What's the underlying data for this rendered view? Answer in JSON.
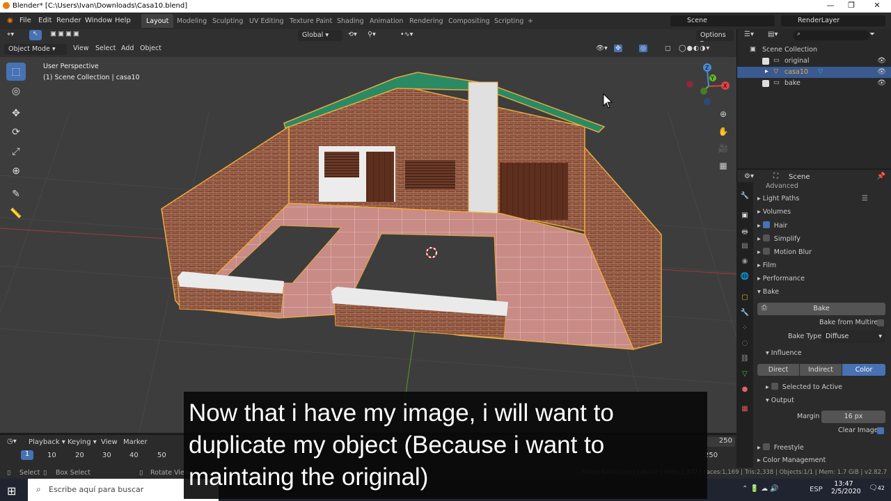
{
  "window": {
    "title": "Blender* [C:\\Users\\Ivan\\Downloads\\Casa10.blend]",
    "minimize": "—",
    "maximize": "❐",
    "close": "✕"
  },
  "menu": {
    "file": "File",
    "edit": "Edit",
    "render": "Render",
    "window": "Window",
    "help": "Help"
  },
  "workspaces": [
    "Layout",
    "Modeling",
    "Sculpting",
    "UV Editing",
    "Texture Paint",
    "Shading",
    "Animation",
    "Rendering",
    "Compositing",
    "Scripting",
    "+"
  ],
  "scene": {
    "name": "Scene",
    "view_layer": "RenderLayer"
  },
  "viewport_header": {
    "transform_orientation": "Global",
    "options": "Options",
    "mode": "Object Mode",
    "view": "View",
    "select": "Select",
    "add": "Add",
    "object": "Object"
  },
  "viewport": {
    "perspective": "User Perspective",
    "collection_info": "(1) Scene Collection | casa10"
  },
  "gizmo": {
    "z": "Z",
    "y": "Y",
    "x": "X"
  },
  "outliner": {
    "root": "Scene Collection",
    "items": [
      {
        "name": "original",
        "selected": false
      },
      {
        "name": "casa10",
        "selected": true
      },
      {
        "name": "bake",
        "selected": false
      }
    ]
  },
  "properties": {
    "context": "Scene",
    "advanced": "Advanced",
    "light_paths": "Light Paths",
    "volumes": "Volumes",
    "hair": "Hair",
    "simplify": "Simplify",
    "motion_blur": "Motion Blur",
    "film": "Film",
    "performance": "Performance",
    "bake_section": "Bake",
    "bake_button": "Bake",
    "bake_from_multires": "Bake from Multires",
    "bake_type_label": "Bake Type",
    "bake_type_value": "Diffuse",
    "influence": "Influence",
    "influence_options": [
      "Direct",
      "Indirect",
      "Color"
    ],
    "selected_to_active": "Selected to Active",
    "output": "Output",
    "margin_label": "Margin",
    "margin_value": "16 px",
    "clear_image": "Clear Image",
    "freestyle": "Freestyle",
    "color_management": "Color Management"
  },
  "timeline": {
    "playback": "Playback",
    "keying": "Keying",
    "view": "View",
    "marker": "Marker",
    "current_frame": "1",
    "end_frame": "250",
    "ticks": [
      "10",
      "20",
      "30",
      "40",
      "50"
    ],
    "right_tick": "250"
  },
  "status": {
    "select": "Select",
    "box_select": "Box Select",
    "rotate_view": "Rotate View",
    "stats": "Scene Collection | casa10 | Verts:1,377 | Faces:1,169 | Tris:2,338 | Objects:1/1 | Mem: 1.7 GiB | v2.82.7"
  },
  "taskbar": {
    "search_placeholder": "Escribe aquí para buscar",
    "lang": "ESP",
    "time": "13:47",
    "date": "2/5/2020",
    "notif": "42"
  },
  "subtitle": "Now that i have my image, i will want to duplicate my object (Because i want to maintaing the original)",
  "colors": {
    "accent": "#4772b3",
    "selection_orange": "#e8a93e",
    "roof_green": "#2a8a63"
  }
}
